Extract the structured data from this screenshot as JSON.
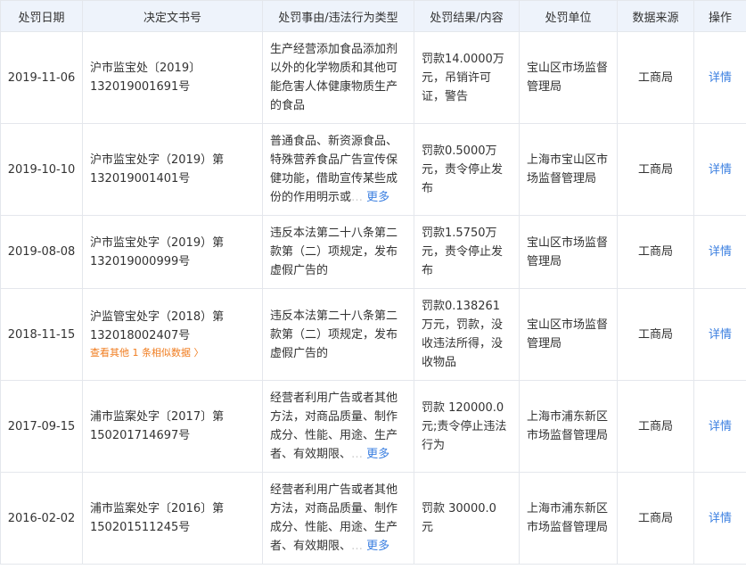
{
  "headers": {
    "date": "处罚日期",
    "doc_no": "决定文书号",
    "reason": "处罚事由/违法行为类型",
    "result": "处罚结果/内容",
    "unit": "处罚单位",
    "source": "数据来源",
    "action": "操作"
  },
  "rows": [
    {
      "date": "2019-11-06",
      "doc_no": "沪市监宝处〔2019〕132019001691号",
      "reason": "生产经营添加食品添加剂以外的化学物质和其他可能危害人体健康物质生产的食品",
      "result": "罚款14.0000万元，吊销许可证，警告",
      "unit": "宝山区市场监督管理局",
      "source": "工商局",
      "action": "详情"
    },
    {
      "date": "2019-10-10",
      "doc_no": "沪市监宝处字（2019）第132019001401号",
      "reason": "普通食品、新资源食品、特殊营养食品广告宣传保健功能，借助宣传某些成份的作用明示或",
      "reason_fade": "…",
      "more": "更多",
      "result": "罚款0.5000万元，责令停止发布",
      "unit": "上海市宝山区市场监督管理局",
      "source": "工商局",
      "action": "详情"
    },
    {
      "date": "2019-08-08",
      "doc_no": "沪市监宝处字（2019）第132019000999号",
      "reason": "违反本法第二十八条第二款第（二）项规定，发布虚假广告的",
      "result": "罚款1.5750万元，责令停止发布",
      "unit": "宝山区市场监督管理局",
      "source": "工商局",
      "action": "详情"
    },
    {
      "date": "2018-11-15",
      "doc_no": "沪监管宝处字（2018）第132018002407号",
      "similar": "查看其他 1 条相似数据 〉",
      "reason": "违反本法第二十八条第二款第（二）项规定，发布虚假广告的",
      "result": "罚款0.138261万元，罚款，没收违法所得，没收物品",
      "unit": "宝山区市场监督管理局",
      "source": "工商局",
      "action": "详情"
    },
    {
      "date": "2017-09-15",
      "doc_no": "浦市监案处字〔2017〕第150201714697号",
      "reason": "经营者利用广告或者其他方法，对商品质量、制作成分、性能、用途、生产者、有效期限、",
      "reason_fade": "…",
      "more": "更多",
      "result": "罚款 120000.0元;责令停止违法行为",
      "unit": "上海市浦东新区市场监督管理局",
      "source": "工商局",
      "action": "详情"
    },
    {
      "date": "2016-02-02",
      "doc_no": "浦市监案处字〔2016〕第150201511245号",
      "reason": "经营者利用广告或者其他方法，对商品质量、制作成分、性能、用途、生产者、有效期限、",
      "reason_fade": "…",
      "more": "更多",
      "result": "罚款 30000.0 元",
      "unit": "上海市浦东新区市场监督管理局",
      "source": "工商局",
      "action": "详情"
    }
  ]
}
